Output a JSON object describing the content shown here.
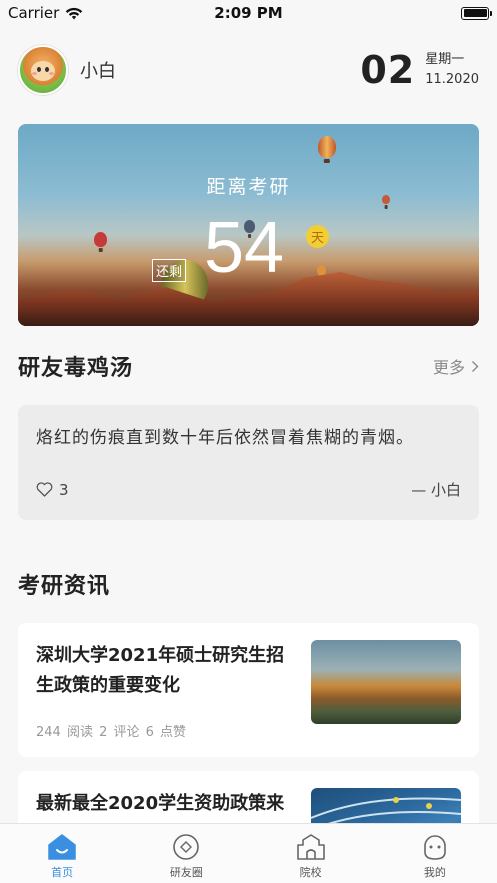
{
  "status_bar": {
    "carrier": "Carrier",
    "time": "2:09 PM"
  },
  "header": {
    "username": "小白",
    "day": "02",
    "weekday": "星期一",
    "month_year": "11.2020"
  },
  "countdown": {
    "title": "距离考研",
    "prefix": "还剩",
    "days": "54",
    "unit": "天"
  },
  "quotes_section": {
    "title": "研友毒鸡汤",
    "more": "更多",
    "quote": "烙红的伤痕直到数十年后依然冒着焦糊的青烟。",
    "likes": "3",
    "author": "— 小白"
  },
  "news_section": {
    "title": "考研资讯",
    "items": [
      {
        "title": "深圳大学2021年硕士研究生招生政策的重要变化",
        "meta": "244 阅读   2 评论   6 点赞"
      },
      {
        "title": "最新最全2020学生资助政策来"
      }
    ]
  },
  "tab_bar": {
    "accent_color": "#3a8fe0",
    "tabs": [
      {
        "label": "首页",
        "icon": "home-icon",
        "active": true
      },
      {
        "label": "研友圈",
        "icon": "circle-icon",
        "active": false
      },
      {
        "label": "院校",
        "icon": "school-icon",
        "active": false
      },
      {
        "label": "我的",
        "icon": "profile-icon",
        "active": false
      }
    ]
  }
}
